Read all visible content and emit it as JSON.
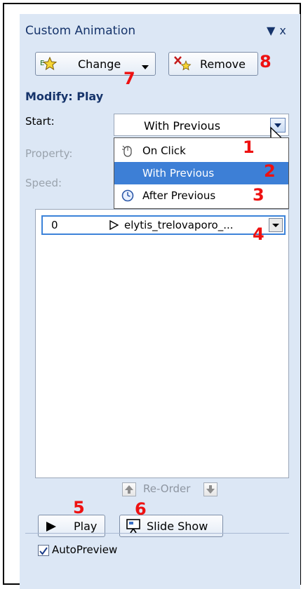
{
  "panel": {
    "title": "Custom Animation",
    "dropdown_glyph": "▼",
    "close_glyph": "x"
  },
  "toolbar": {
    "change_label": "Change",
    "remove_label": "Remove",
    "change_icon": "star-effect-icon",
    "remove_icon": "remove-effect-icon"
  },
  "modify": {
    "title": "Modify: Play",
    "start_label": "Start:",
    "property_label": "Property:",
    "speed_label": "Speed:",
    "start_value": "With Previous"
  },
  "start_menu": {
    "items": [
      {
        "label": "On Click",
        "icon": "mouse-click-icon"
      },
      {
        "label": "With Previous",
        "icon": ""
      },
      {
        "label": "After Previous",
        "icon": "clock-icon"
      }
    ]
  },
  "effects_list": {
    "items": [
      {
        "index": "0",
        "name": "elytis_trelovaporo_...",
        "icon": "play-triangle-icon"
      }
    ]
  },
  "reorder": {
    "label": "Re-Order"
  },
  "bottom": {
    "play_label": "Play",
    "slideshow_label": "Slide Show",
    "autopreview_label": "AutoPreview",
    "autopreview_checked": true
  },
  "callouts": [
    "1",
    "2",
    "3",
    "4",
    "5",
    "6",
    "7",
    "8"
  ],
  "colors": {
    "accent": "#16346b",
    "selection": "#3d7fd6",
    "callout": "#ee1111",
    "panel_bg": "#dce7f5"
  }
}
